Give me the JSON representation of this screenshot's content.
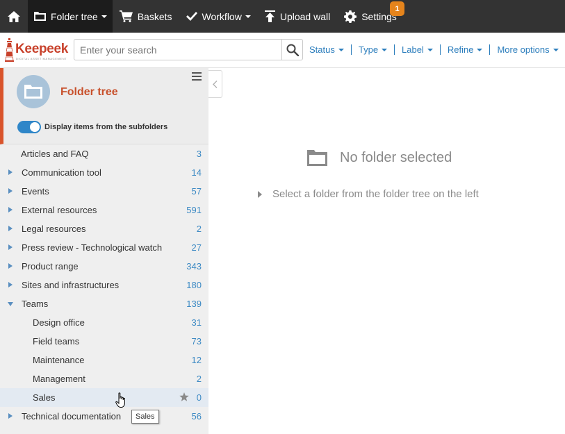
{
  "topbar": {
    "items": [
      {
        "label": "Folder tree",
        "icon": "folder-icon"
      },
      {
        "label": "Baskets",
        "icon": "cart-icon"
      },
      {
        "label": "Workflow",
        "icon": "check-icon"
      },
      {
        "label": "Upload wall",
        "icon": "upload-icon"
      },
      {
        "label": "Settings",
        "icon": "gear-icon"
      }
    ],
    "settings_badge": "1"
  },
  "brand": {
    "name": "Keepeek",
    "tagline": "DIGITAL ASSET MANAGEMENT"
  },
  "search": {
    "placeholder": "Enter your search",
    "value": ""
  },
  "filters": [
    "Status",
    "Type",
    "Label",
    "Refine",
    "More options"
  ],
  "sidebar": {
    "title": "Folder tree",
    "toggle_label": "Display items from the subfolders",
    "toggle_on": true,
    "folders": [
      {
        "label": "Articles and FAQ",
        "count": "3"
      },
      {
        "label": "Communication tool",
        "count": "14"
      },
      {
        "label": "Events",
        "count": "57"
      },
      {
        "label": "External resources",
        "count": "591"
      },
      {
        "label": "Legal resources",
        "count": "2"
      },
      {
        "label": "Press review - Technological watch",
        "count": "27"
      },
      {
        "label": "Product range",
        "count": "343"
      },
      {
        "label": "Sites and infrastructures",
        "count": "180"
      },
      {
        "label": "Teams",
        "count": "139"
      },
      {
        "label": "Design office",
        "count": "31"
      },
      {
        "label": "Field teams",
        "count": "73"
      },
      {
        "label": "Maintenance",
        "count": "12"
      },
      {
        "label": "Management",
        "count": "2"
      },
      {
        "label": "Sales",
        "count": "0"
      },
      {
        "label": "Technical documentation",
        "count": "56"
      }
    ],
    "tooltip": "Sales"
  },
  "main": {
    "empty_title": "No folder selected",
    "empty_hint": "Select a folder from the folder tree on the left"
  },
  "colors": {
    "accent": "#d9542b",
    "link": "#2b7dbc",
    "topbar": "#333333",
    "badge": "#e5841c"
  }
}
